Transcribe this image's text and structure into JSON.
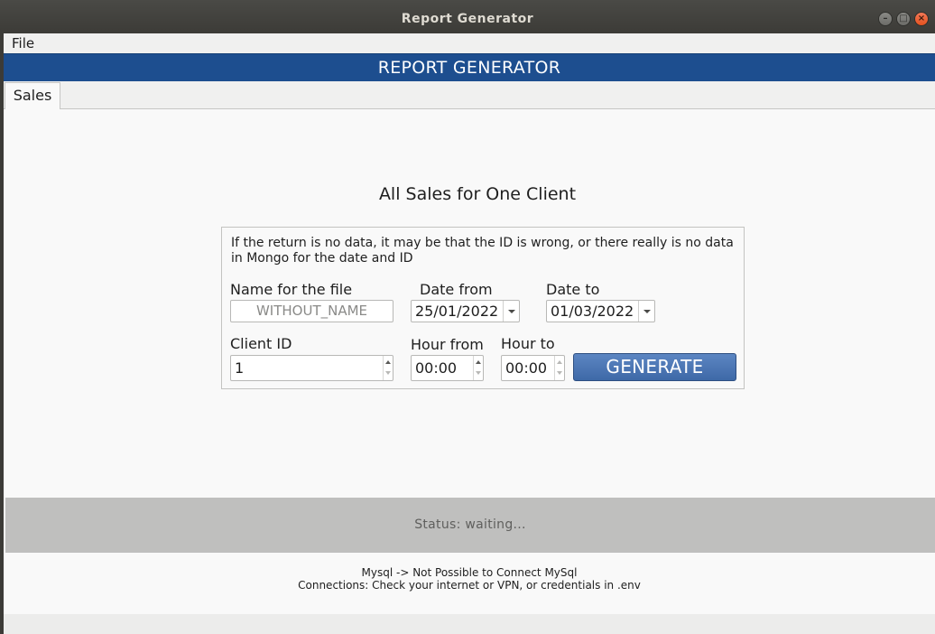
{
  "window": {
    "title": "Report Generator"
  },
  "menubar": {
    "file_label": "File"
  },
  "banner": {
    "title": "REPORT GENERATOR"
  },
  "tabs": [
    {
      "label": "Sales",
      "selected": true
    }
  ],
  "form": {
    "section_title": "All Sales for One Client",
    "info_text": "If the return is no data, it may be that the ID is wrong, or there really is no data in Mongo for the date and ID",
    "file_name": {
      "label": "Name for the file",
      "placeholder": "WITHOUT_NAME",
      "value": ""
    },
    "date_from": {
      "label": "Date from",
      "value": "25/01/2022"
    },
    "date_to": {
      "label": "Date to",
      "value": "01/03/2022"
    },
    "client_id": {
      "label": "Client ID",
      "value": "1"
    },
    "hour_from": {
      "label": "Hour from",
      "value": "00:00"
    },
    "hour_to": {
      "label": "Hour to",
      "value": "00:00"
    },
    "generate_label": "GENERATE"
  },
  "status": {
    "text": "Status: waiting..."
  },
  "messages": {
    "line1": "Mysql -> Not Possible to Connect MySql",
    "line2": "Connections: Check your internet or VPN, or credentials in .env"
  },
  "colors": {
    "banner": "#1d4e8f",
    "generate_button": "#4a74b2",
    "status_bar": "#bfbfbe",
    "close_button": "#e9602f"
  },
  "icons": {
    "minimize": "minimize-icon",
    "maximize": "maximize-icon",
    "close": "close-icon",
    "combo_arrow": "chevron-down-icon",
    "spin": "spin-arrows-icon"
  }
}
